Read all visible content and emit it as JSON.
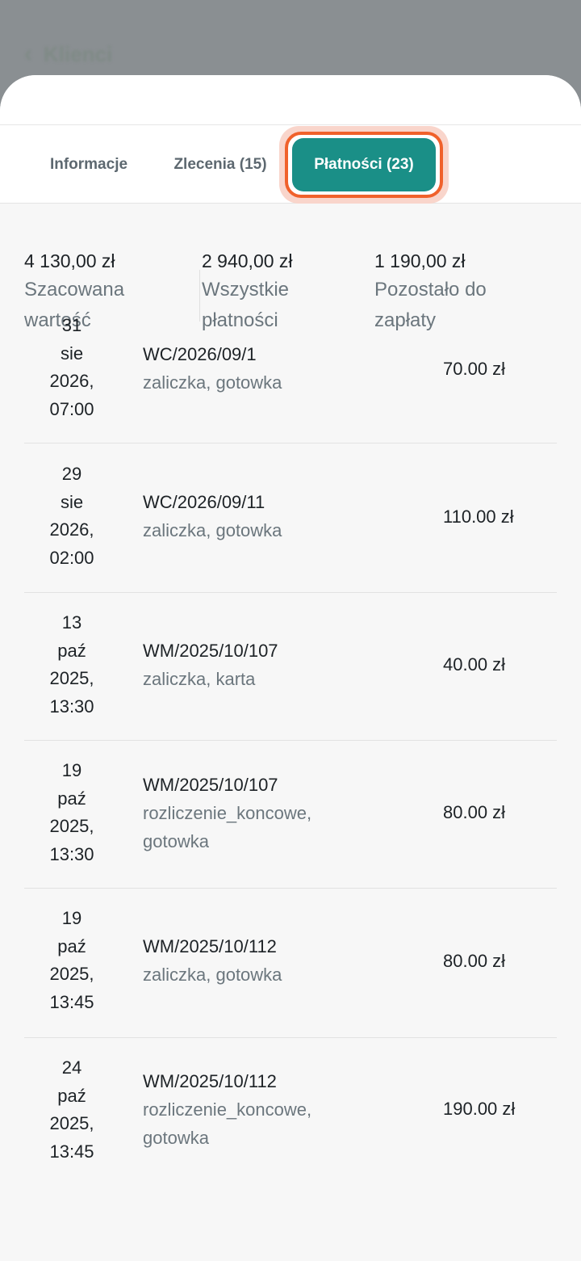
{
  "backdrop": {
    "back_label": "Klienci"
  },
  "sheet": {
    "corner_glyph": ">"
  },
  "tabs": [
    {
      "label": "Informacje",
      "active": false
    },
    {
      "label": "Zlecenia (15)",
      "active": false
    },
    {
      "label": "Płatności (23)",
      "active": true
    }
  ],
  "summary": [
    {
      "amount": "4 130,00 zł",
      "label_line1": "Szacowana",
      "label_line2": "wartość"
    },
    {
      "amount": "2 940,00 zł",
      "label_line1": "Wszystkie",
      "label_line2": "płatności"
    },
    {
      "amount": "1 190,00 zł",
      "label_line1": "Pozostało do",
      "label_line2": "zapłaty"
    }
  ],
  "payments": [
    {
      "day": "31",
      "month": "sie",
      "year": "2026,",
      "time": "07:00",
      "ref": "WC/2026/09/1",
      "desc1": "zaliczka, gotowka",
      "desc2": "",
      "amount": "70.00 zł"
    },
    {
      "day": "29",
      "month": "sie",
      "year": "2026,",
      "time": "02:00",
      "ref": "WC/2026/09/11",
      "desc1": "zaliczka, gotowka",
      "desc2": "",
      "amount": "110.00 zł"
    },
    {
      "day": "13",
      "month": "paź",
      "year": "2025,",
      "time": "13:30",
      "ref": "WM/2025/10/107",
      "desc1": "zaliczka, karta",
      "desc2": "",
      "amount": "40.00 zł"
    },
    {
      "day": "19",
      "month": "paź",
      "year": "2025,",
      "time": "13:30",
      "ref": "WM/2025/10/107",
      "desc1": "rozliczenie_koncowe,",
      "desc2": "gotowka",
      "amount": "80.00 zł"
    },
    {
      "day": "19",
      "month": "paź",
      "year": "2025,",
      "time": "13:45",
      "ref": "WM/2025/10/112",
      "desc1": "zaliczka, gotowka",
      "desc2": "",
      "amount": "80.00 zł"
    },
    {
      "day": "24",
      "month": "paź",
      "year": "2025,",
      "time": "13:45",
      "ref": "WM/2025/10/112",
      "desc1": "rozliczenie_koncowe,",
      "desc2": "gotowka",
      "amount": "190.00 zł"
    }
  ]
}
